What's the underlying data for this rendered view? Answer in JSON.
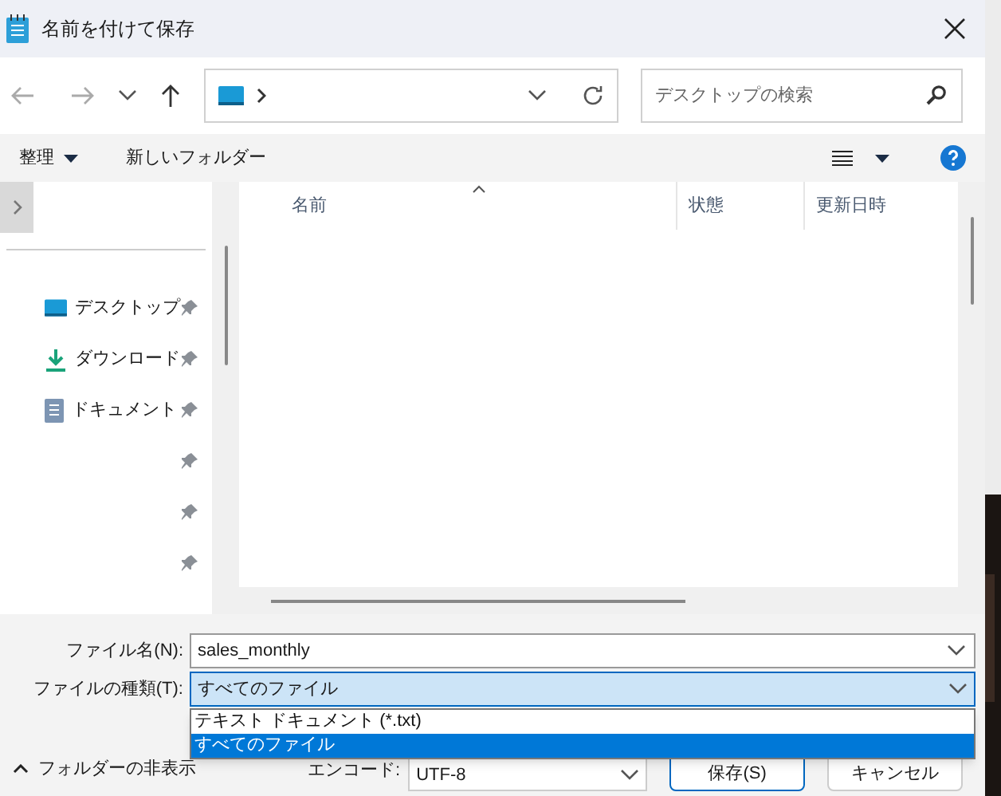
{
  "window": {
    "title": "名前を付けて保存"
  },
  "nav": {
    "search": {
      "placeholder": "デスクトップの検索"
    }
  },
  "toolbar": {
    "organize": "整理",
    "new_folder": "新しいフォルダー"
  },
  "sidebar": {
    "items": [
      {
        "kind": "desktop",
        "label": "デスクトップ"
      },
      {
        "kind": "download",
        "label": "ダウンロード"
      },
      {
        "kind": "document",
        "label": "ドキュメント"
      },
      {
        "kind": "none"
      },
      {
        "kind": "none"
      },
      {
        "kind": "none"
      }
    ]
  },
  "table": {
    "columns": [
      "名前",
      "状態",
      "更新日時"
    ]
  },
  "form": {
    "file_name": {
      "label": "ファイル名(N):",
      "value": "sales_monthly"
    },
    "file_type": {
      "label": "ファイルの種類(T):",
      "value": "すべてのファイル",
      "expanded": true,
      "options": [
        {
          "label": "テキスト ドキュメント (*.txt)",
          "selected": false
        },
        {
          "label": "すべてのファイル",
          "selected": true
        }
      ]
    }
  },
  "footer": {
    "hide_folders": "フォルダーの非表示",
    "encoding": {
      "label": "エンコード:",
      "value": "UTF-8"
    },
    "buttons": [
      {
        "label": "保存(S)",
        "kind": "primary"
      },
      {
        "label": "キャンセル",
        "kind": "secondary"
      }
    ]
  }
}
